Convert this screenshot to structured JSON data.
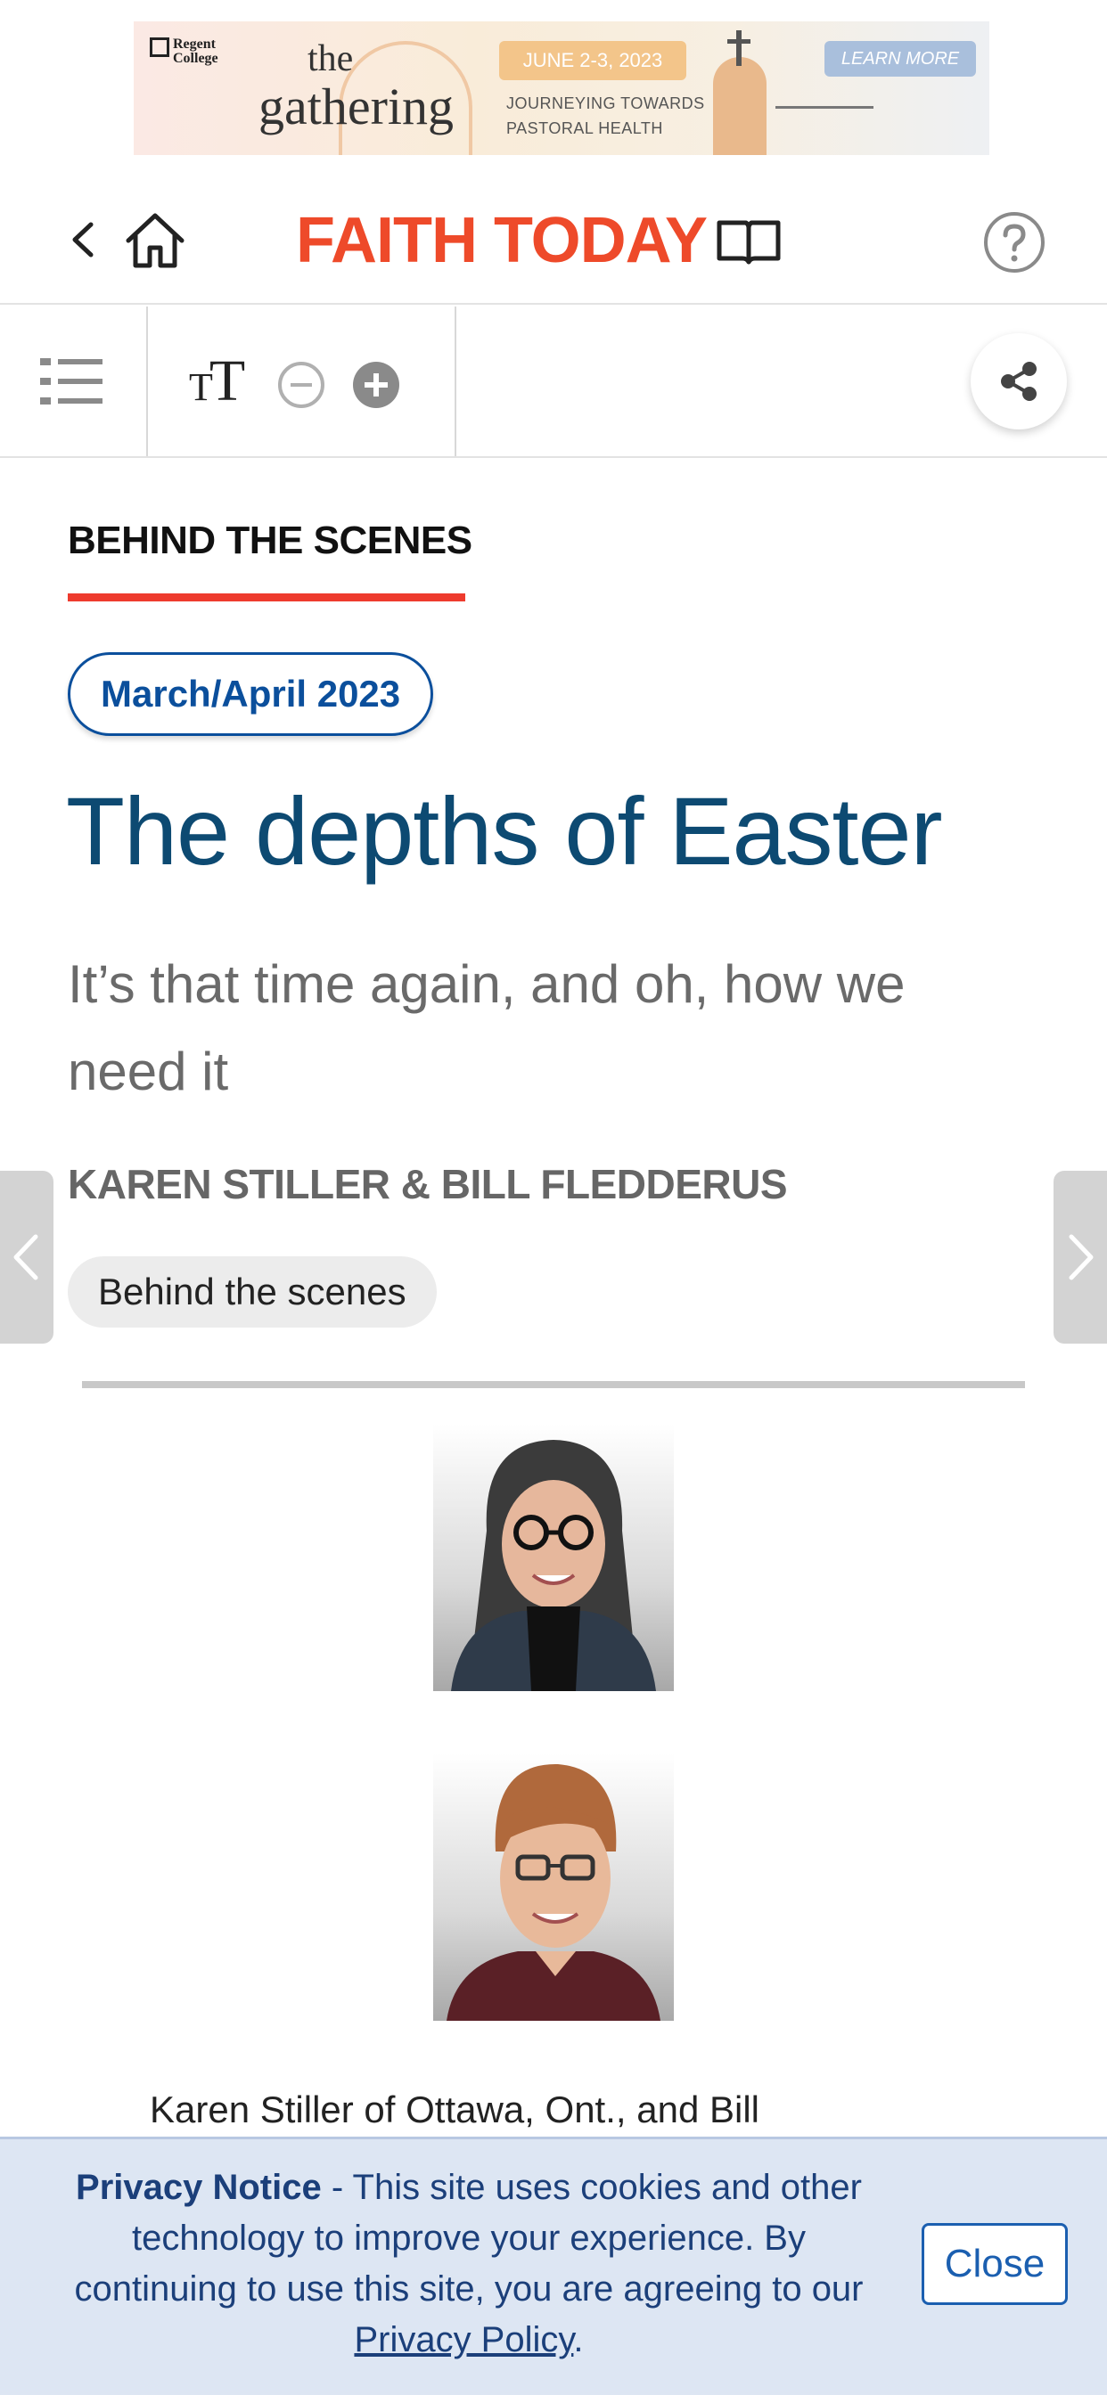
{
  "ad": {
    "logo_text": "Regent College",
    "title_top": "the",
    "title_main": "gathering",
    "date": "JUNE 2-3, 2023",
    "tagline_1": "JOURNEYING TOWARDS",
    "tagline_2": "PASTORAL HEALTH",
    "cta": "LEARN MORE"
  },
  "header": {
    "logo_text": "FAITH TODAY",
    "icons": [
      "back-icon",
      "home-icon",
      "book-icon",
      "help-icon"
    ]
  },
  "toolbar": {
    "text_size_label": "TT",
    "icons": [
      "list-icon",
      "text-size-icon",
      "minus-icon",
      "plus-icon",
      "share-icon"
    ]
  },
  "article": {
    "section": "BEHIND THE SCENES",
    "issue": "March/April 2023",
    "title": "The depths of Easter",
    "subtitle": "It’s that time again, and oh, how we need it",
    "byline": "KAREN STILLER & BILL FLEDDERUS",
    "tag": "Behind the scenes",
    "body_start": "Karen Stiller of Ottawa, Ont., and Bill"
  },
  "privacy": {
    "heading": "Privacy Notice",
    "text": " - This site uses cookies and other technology to improve your experience. By continuing to use this site, you are agreeing to our ",
    "link": "Privacy Policy",
    "end": ".",
    "close": "Close"
  },
  "colors": {
    "brand": "#ee4a2a",
    "title": "#0d4a72",
    "accent_blue": "#0b4f9c",
    "section_underline": "#ee3b2e",
    "privacy_bg": "#dde6f3"
  }
}
